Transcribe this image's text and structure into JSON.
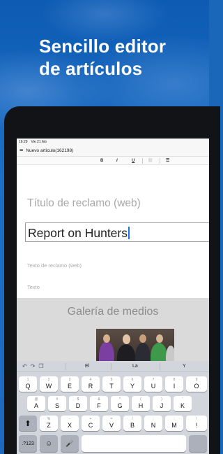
{
  "hero": {
    "line1": "Sencillo editor",
    "line2": "de artículos"
  },
  "status_bar": {
    "time": "16:29",
    "date": "Vie 21 feb"
  },
  "nav_bar": {
    "menu_icon": "more-dots-icon",
    "title": "Nuevo artículo(162198)"
  },
  "format_bar": {
    "bold": "B",
    "italic": "I",
    "underline": "U",
    "link_icon": "link-icon",
    "list_icon": "list-icon"
  },
  "editor": {
    "title_placeholder": "Título de reclamo (web)",
    "headline_value": "Report on Hunters",
    "subtitle_placeholder": "Texto de reclamo (web)",
    "body_placeholder": "Texto"
  },
  "gallery": {
    "title": "Galería de medios"
  },
  "keyboard": {
    "suggestions": [
      "El",
      "La",
      "Y"
    ],
    "row1": [
      {
        "alt": "1",
        "key": "Q"
      },
      {
        "alt": "2",
        "key": "W"
      },
      {
        "alt": "3",
        "key": "E"
      },
      {
        "alt": "4",
        "key": "R"
      },
      {
        "alt": "5",
        "key": "T"
      },
      {
        "alt": "6",
        "key": "Y"
      },
      {
        "alt": "7",
        "key": "U"
      },
      {
        "alt": "8",
        "key": "I"
      },
      {
        "alt": "9",
        "key": "O"
      }
    ],
    "row2": [
      {
        "alt": "@",
        "key": "A"
      },
      {
        "alt": "#",
        "key": "S"
      },
      {
        "alt": "$",
        "key": "D"
      },
      {
        "alt": "&",
        "key": "F"
      },
      {
        "alt": "*",
        "key": "G"
      },
      {
        "alt": "(",
        "key": "H"
      },
      {
        "alt": ")",
        "key": "J"
      },
      {
        "alt": "'",
        "key": "K"
      }
    ],
    "row3": [
      {
        "alt": "%",
        "key": "Z"
      },
      {
        "alt": "-",
        "key": "X"
      },
      {
        "alt": "+",
        "key": "C"
      },
      {
        "alt": "=",
        "key": "V"
      },
      {
        "alt": "/",
        "key": "B"
      },
      {
        "alt": ";",
        "key": "N"
      },
      {
        "alt": ":",
        "key": "M"
      },
      {
        "alt": "!",
        "key": "!"
      }
    ],
    "numbers_key": ".?123",
    "shift_icon": "shift-icon",
    "emoji_icon": "emoji-icon",
    "mic_icon": "microphone-icon"
  }
}
